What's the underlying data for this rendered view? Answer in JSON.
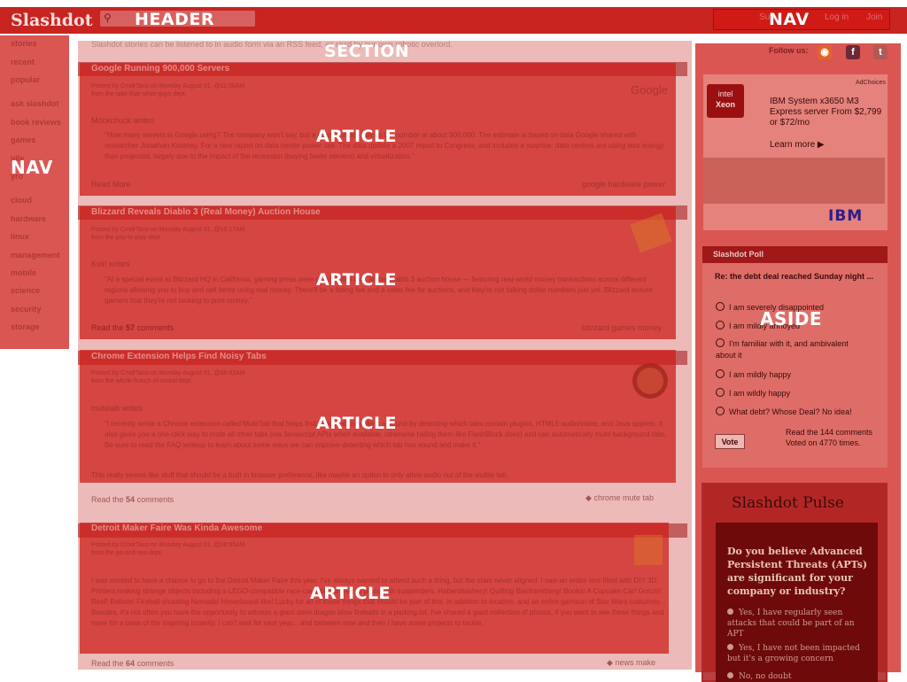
{
  "header": {
    "logo": "Slashdot",
    "search_icon": "search-icon",
    "region_label": "HEADER",
    "nav_region_label": "NAV",
    "links": [
      "Sub",
      "Log in",
      "Join"
    ]
  },
  "left_nav": {
    "region_label": "NAV",
    "items": [
      "stories",
      "recent",
      "popular",
      "ask slashdot",
      "book reviews",
      "games",
      "idle",
      "yro",
      "cloud",
      "hardware",
      "linux",
      "management",
      "mobile",
      "science",
      "security",
      "storage"
    ]
  },
  "section": {
    "region_label": "SECTION",
    "intro": "Slashdot stories can be listened to in audio form via an RSS feed, as read by our own robotic overlord."
  },
  "articles": [
    {
      "region_label": "ARTICLE",
      "title": "Google Running 900,000 Servers",
      "meta": "Posted by CmdrTaco on Monday August 01, @11:30AM",
      "meta2": "from the take-that-other-guys dept.",
      "submitter": "Mockchuck writes",
      "body": "\"How many servers is Google using? The company won't say, but a new estimate places the number at about 900,000. The estimate is based on data Google shared with researcher Jonathan Koomey. For a new report on data center power use. The data update a 2007 report to Congress, and includes a surprise: data centers are using less energy than projected, largely due to the impact of the recession (buying fewer servers) and virtualization.\"",
      "foot": "Read More",
      "tags": "google  hardware  power",
      "icon": "google-logo"
    },
    {
      "region_label": "ARTICLE",
      "title": "Blizzard Reveals Diablo 3 (Real Money) Auction House",
      "meta": "Posted by CmdrTaco on Monday August 01, @10:17AM",
      "meta2": "from the pay-to-play dept.",
      "submitter": "Ksirl writes",
      "body": "\"At a special event at Blizzard HQ in California, gaming press were given a first look at the Diablo 3 auction house — featuring real-world money transactions across different regions allowing you to buy and sell items using real money. There'll be a listing fee and a sales fee for auctions, and they're not talking dollar numbers just yet. Blizzard assure gamers that they're not looking to print money.\"",
      "foot_prefix": "Read the",
      "comments": "57",
      "foot_suffix": "comments",
      "tags": "blizzard  games  money",
      "icon": "money-icon"
    },
    {
      "region_label": "ARTICLE",
      "title": "Chrome Extension Helps Find Noisy Tabs",
      "meta": "Posted by CmdrTaco on Monday August 01, @09:42AM",
      "meta2": "from the whole-bunch-of-sound dept.",
      "submitter": "mutelab writes",
      "body": "\"I recently wrote a Chrome extension called MuteTab that helps find which tab is making a sound by detecting which tabs contain plugins, HTML5 audio/video, and Java applets. It also gives you a one-click way to mute all other tabs (via Javascript APIs when available, otherwise hiding them like FlashBlock does) and can automatically mute background tabs. Be sure to read the FAQ writeup to learn about some ways we can improve detecting which tab has sound and make it.\"",
      "extra": "This really seems like stuff that should be a built in browser preference, like maybe an option to only allow audio out of the visible tab.",
      "foot_prefix": "Read the",
      "comments": "54",
      "foot_suffix": "comments",
      "tags": "chrome  mute  tab",
      "icon": "chrome-icon"
    },
    {
      "region_label": "ARTICLE",
      "title": "Detroit Maker Faire Was Kinda Awesome",
      "meta": "Posted by CmdrTaco on Monday August 01, @08:55AM",
      "meta2": "from the go-and-see dept.",
      "body": "I was excited to have a chance to go to the Detroit Maker Faire this year. I've always wanted to attend such a thing, but the stars never aligned. I saw an entire tent filled with DIY 3D Printers making strange objects including a LEGO-compatible race-car, utilikilts held in place with suspenders, Habershashery! Quilting Blacksmithing! Books! A Cupcake Car! Gonzo! Reef! Robots! Fireball-shooting Nomads! Hoverboard-like! Lucky for all of these things that should be part of this. In addition to location, and an entire garrison of Star Wars costumes... Besides, it's not often you have the opportunity to witness a giant steel dragon blow fireballs in a parking lot. I've shared a giant collection of photos, if you want to see these things and more for a taste of the inspiring insanity. I can't wait for next year... and between now and then I have some projects to tackle.",
      "foot_prefix": "Read the",
      "comments": "64",
      "foot_suffix": "comments",
      "tags": "news  make",
      "icon": "maker-icon"
    }
  ],
  "aside": {
    "region_label": "ASIDE",
    "follow_label": "Follow us:",
    "social": [
      "rss-icon",
      "facebook-icon",
      "twitter-icon"
    ],
    "ad": {
      "badge_line1": "intel",
      "badge_line2": "Xeon",
      "text": "IBM System x3650 M3 Express server From $2,799 or $72/mo",
      "learn_more": "Learn more ▶",
      "brand": "IBM",
      "adchoices": "AdChoices"
    },
    "poll": {
      "title": "Slashdot Poll",
      "question": "Re: the debt deal reached Sunday night ...",
      "options": [
        "I am severely disappointed",
        "I am mildly annoyed",
        "I'm familiar with it, and ambivalent about it",
        "I am mildly happy",
        "I am wildly happy",
        "What debt? Whose Deal? No idea!"
      ],
      "vote_label": "Vote",
      "stats_line1": "Read the 144 comments",
      "stats_line2": "Voted on 4770 times."
    },
    "pulse": {
      "title": "Slashdot Pulse",
      "question": "Do you believe Advanced Persistent Threats (APTs) are significant for your company or industry?",
      "options": [
        "Yes, I have regularly seen attacks that could be part of an APT",
        "Yes, I have not been impacted but it's a growing concern",
        "No, no doubt"
      ]
    }
  },
  "colors": {
    "overlay": "#cd1e19",
    "header_bg": "#b83a36",
    "ibm_blue": "#2b1c8a"
  }
}
